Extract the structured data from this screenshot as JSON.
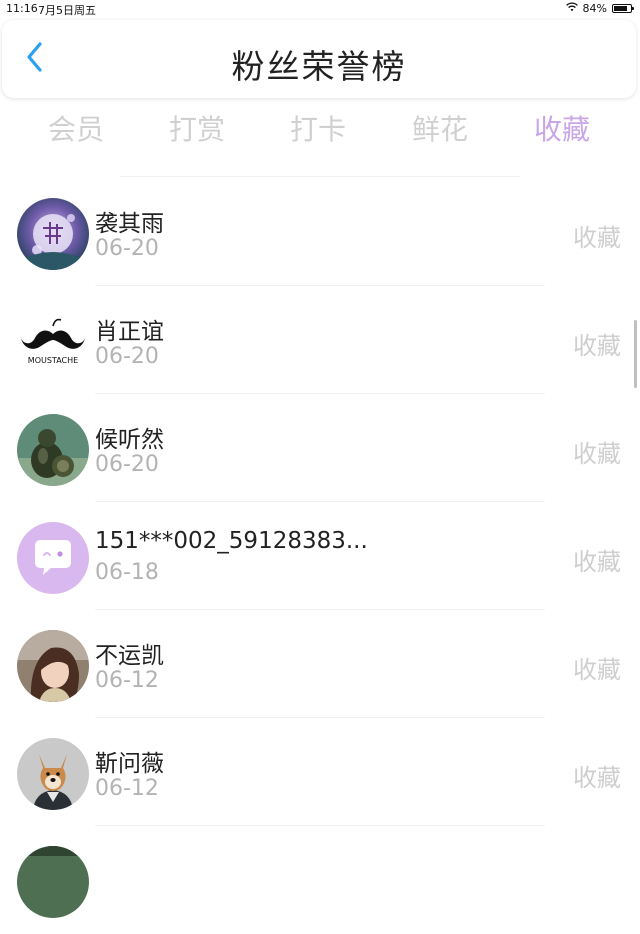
{
  "status": {
    "time": "11:16",
    "date": "7月5日周五",
    "battery": "84%",
    "battery_level": 0.84
  },
  "header": {
    "title": "粉丝荣誉榜"
  },
  "tabs": [
    {
      "label": "会员",
      "active": false
    },
    {
      "label": "打赏",
      "active": false
    },
    {
      "label": "打卡",
      "active": false
    },
    {
      "label": "鲜花",
      "active": false
    },
    {
      "label": "收藏",
      "active": true
    }
  ],
  "rows": [
    {
      "name": "袭其雨",
      "date": "06-20",
      "type": "收藏",
      "avatar": "moon-flower-avatar"
    },
    {
      "name": "肖正谊",
      "date": "06-20",
      "type": "收藏",
      "avatar": "moustache-avatar",
      "avatar_text": "MOUSTACHE"
    },
    {
      "name": "候听然",
      "date": "06-20",
      "type": "收藏",
      "avatar": "statue-avatar"
    },
    {
      "name": "151***002_59128383...",
      "date": "06-18",
      "type": "收藏",
      "avatar": "default-chat-avatar"
    },
    {
      "name": "不运凯",
      "date": "06-12",
      "type": "收藏",
      "avatar": "girl-photo-avatar"
    },
    {
      "name": "靳问薇",
      "date": "06-12",
      "type": "收藏",
      "avatar": "dog-photo-avatar"
    }
  ],
  "colors": {
    "active_tab": "#c9a6e6",
    "inactive_tab": "#d0d0d0",
    "back_arrow": "#2aa0f0"
  }
}
